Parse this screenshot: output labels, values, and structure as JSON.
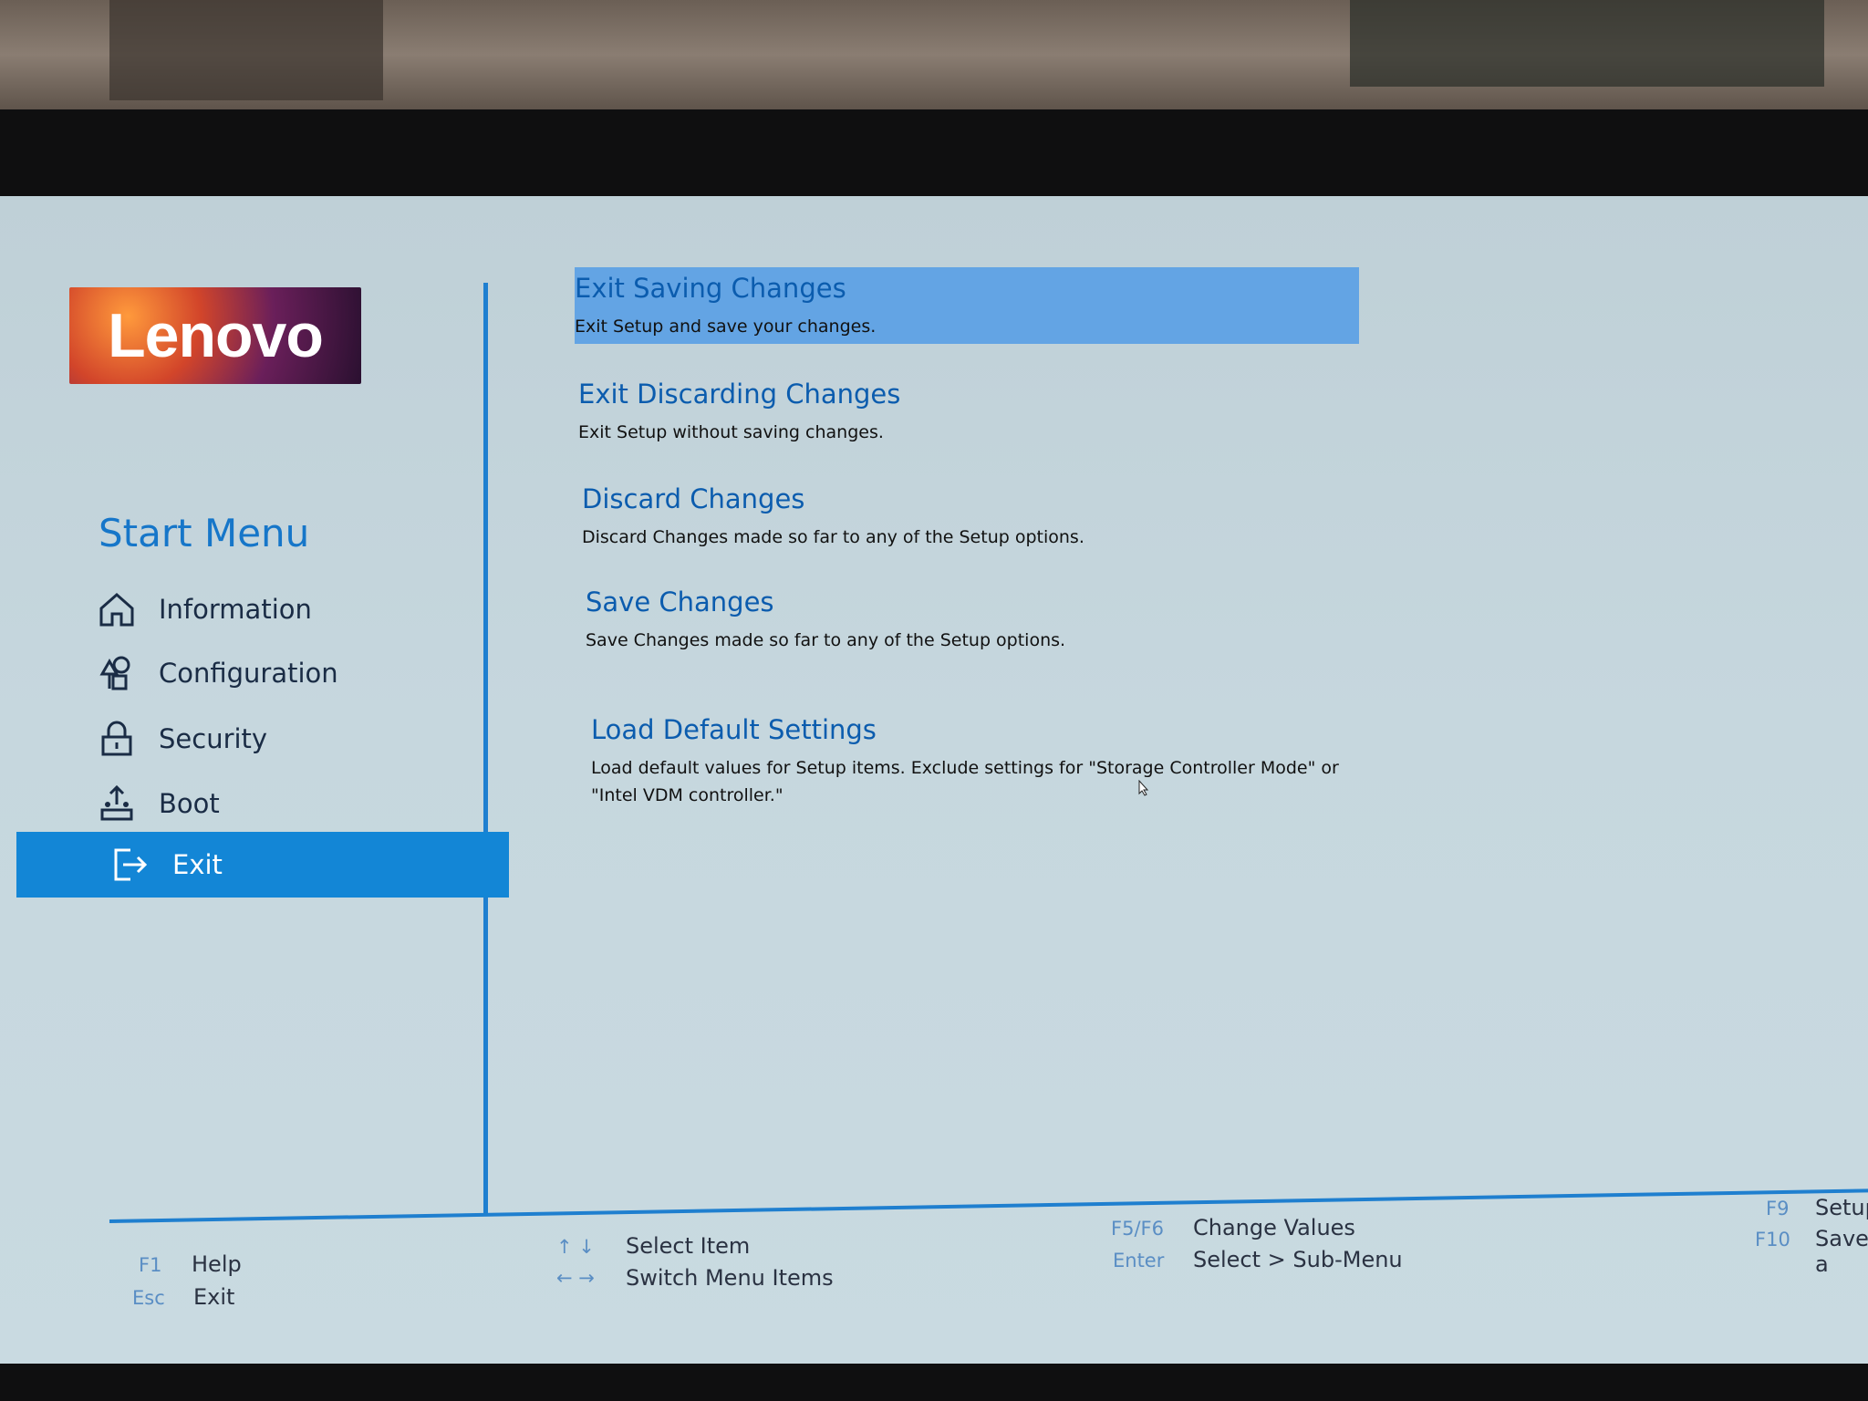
{
  "brand": {
    "logo_text": "Lenovo"
  },
  "sidebar": {
    "title": "Start Menu",
    "items": [
      {
        "label": "Information",
        "icon": "home-icon",
        "active": false
      },
      {
        "label": "Configuration",
        "icon": "configuration-icon",
        "active": false
      },
      {
        "label": "Security",
        "icon": "lock-icon",
        "active": false
      },
      {
        "label": "Boot",
        "icon": "boot-icon",
        "active": false
      },
      {
        "label": "Exit",
        "icon": "exit-icon",
        "active": true
      }
    ]
  },
  "main": {
    "items": [
      {
        "title": "Exit Saving Changes",
        "desc": "Exit Setup and save your changes.",
        "selected": true
      },
      {
        "title": "Exit Discarding Changes",
        "desc": "Exit Setup without saving changes.",
        "selected": false
      },
      {
        "title": "Discard Changes",
        "desc": "Discard Changes made so far to any of the Setup options.",
        "selected": false
      },
      {
        "title": "Save Changes",
        "desc": "Save Changes made so far to any of the Setup options.",
        "selected": false
      },
      {
        "title": "Load Default Settings",
        "desc": "Load default values for Setup items. Exclude settings for \"Storage Controller Mode\" or \"Intel VDM controller.\"",
        "selected": false
      }
    ]
  },
  "footer": {
    "keys": [
      {
        "key": "F1",
        "action": "Help"
      },
      {
        "key": "Esc",
        "action": "Exit"
      },
      {
        "key": "↑ ↓",
        "action": "Select Item"
      },
      {
        "key": "← →",
        "action": "Switch Menu Items"
      },
      {
        "key": "F5/F6",
        "action": "Change Values"
      },
      {
        "key": "Enter",
        "action": "Select > Sub-Menu"
      },
      {
        "key": "F9",
        "action": "Setup"
      },
      {
        "key": "F10",
        "action": "Save a"
      }
    ]
  },
  "colors": {
    "accent": "#1386d6",
    "selection": "#63a4e4",
    "title_blue": "#0b5cae",
    "screen_bg": "#c6d7de"
  }
}
